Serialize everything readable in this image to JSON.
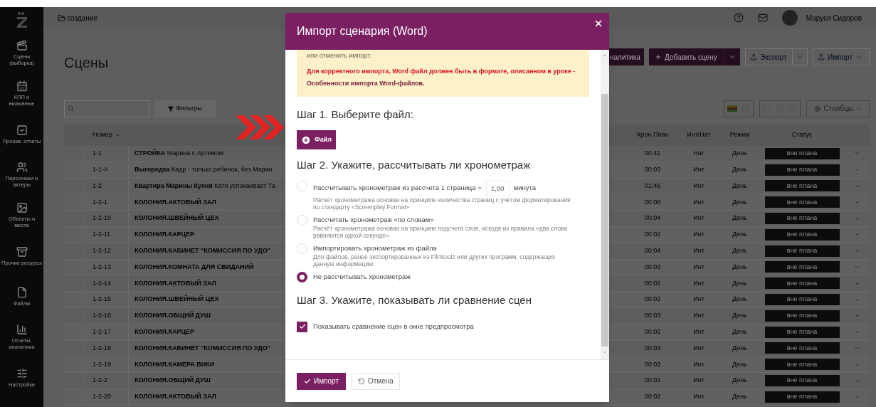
{
  "sidebar": {
    "items": [
      {
        "label": "Сцены (выборка)"
      },
      {
        "label": "КПП и вызывные"
      },
      {
        "label": "Произв. отчеты"
      },
      {
        "label": "Персонажи и актеры"
      },
      {
        "label": "Объекты и места"
      },
      {
        "label": "Прочие ресурсы"
      },
      {
        "label": "Файлы"
      },
      {
        "label": "Отчеты, аналитика"
      },
      {
        "label": "Настройки"
      }
    ]
  },
  "topbar": {
    "breadcrumb": "создание",
    "user_name": "Маруся Сидоров"
  },
  "page": {
    "title": "Сцены",
    "actions": [
      {
        "label": "налитика",
        "kind": "primary"
      },
      {
        "label": "Добавить сцену",
        "kind": "primary-split"
      },
      {
        "label": "Экспорт",
        "kind": "split"
      },
      {
        "label": "Импорт",
        "kind": "dropdown"
      }
    ]
  },
  "toolbar": {
    "filter_button": "Фильтры",
    "columns_button": "Столбцы"
  },
  "table": {
    "columns": [
      "Номер",
      "Хрон.План",
      "Инт/Нат",
      "Режим",
      "Статус"
    ],
    "rows": [
      {
        "number": "1-1",
        "title": "СТРОЙКА",
        "summary": "Марина с Артемом",
        "duration": "00:41",
        "int_ext": "Нат",
        "mode": "День",
        "status": "вне плана"
      },
      {
        "number": "1-1-А",
        "title": "Выгородка",
        "summary": "Кадр - только ребенок, без Марин",
        "duration": "00:03",
        "int_ext": "Инт",
        "mode": "День",
        "status": "вне плана"
      },
      {
        "number": "1-2",
        "title": "Квартира Марины Кухня",
        "summary": "Катя успокаивает Та",
        "duration": "01:46",
        "int_ext": "Инт",
        "mode": "День",
        "status": "вне плана"
      },
      {
        "number": "1-2-1",
        "title": "КОЛОНИЯ.АКТОВЫЙ ЗАЛ",
        "duration": "00:08",
        "int_ext": "Инт",
        "mode": "День",
        "status": "вне плана"
      },
      {
        "number": "1-2-10",
        "title": "КОЛОНИЯ.ШВЕЙНЫЙ ЦЕХ",
        "duration": "00:04",
        "int_ext": "Инт",
        "mode": "День",
        "status": "вне плана"
      },
      {
        "number": "1-2-11",
        "title": "КОЛОНИЯ.КАРЦЕР",
        "duration": "00:02",
        "int_ext": "Инт",
        "mode": "День",
        "status": "вне плана"
      },
      {
        "number": "1-2-12",
        "title": "КОЛОНИЯ.КАБИНЕТ \"КОМИССИЯ ПО УДО\"",
        "duration": "00:04",
        "int_ext": "Инт",
        "mode": "День",
        "status": "вне плана"
      },
      {
        "number": "1-2-13",
        "title": "КОЛОНИЯ.КОМНАТА ДЛЯ СВИДАНИЙ",
        "duration": "00:03",
        "int_ext": "Инт",
        "mode": "День",
        "status": "вне плана"
      },
      {
        "number": "1-2-14",
        "title": "КОЛОНИЯ.АКТОВЫЙ ЗАЛ",
        "duration": "00:02",
        "int_ext": "Инт",
        "mode": "День",
        "status": "вне плана"
      },
      {
        "number": "1-2-15",
        "title": "КОЛОНИЯ.ШВЕЙНЫЙ ЦЕХ",
        "duration": "00:02",
        "int_ext": "Инт",
        "mode": "День",
        "status": "вне плана"
      },
      {
        "number": "1-2-16",
        "title": "КОЛОНИЯ.ОБЩИЙ ДУШ",
        "duration": "00:03",
        "int_ext": "Инт",
        "mode": "День",
        "status": "вне плана"
      },
      {
        "number": "1-2-17",
        "title": "КОЛОНИЯ.КАРЦЕР",
        "duration": "00:02",
        "int_ext": "Инт",
        "mode": "День",
        "status": "вне плана"
      },
      {
        "number": "1-2-18",
        "title": "КОЛОНИЯ.КАБИНЕТ \"КОМИССИЯ ПО УДО\"",
        "duration": "00:03",
        "int_ext": "Инт",
        "mode": "День",
        "status": "вне плана"
      },
      {
        "number": "1-2-19",
        "title": "КОЛОНИЯ.КАМЕРА ВИКИ",
        "duration": "00:03",
        "int_ext": "Инт",
        "mode": "День",
        "status": "вне плана"
      },
      {
        "number": "1-2-2",
        "title": "КОЛОНИЯ.ОБЩИЙ ДУШ",
        "duration": "00:02",
        "int_ext": "Инт",
        "mode": "День",
        "status": "вне плана"
      },
      {
        "number": "1-2-20",
        "title": "КОЛОНИЯ.АКТОВЫЙ ЗАЛ",
        "duration": "00:02",
        "int_ext": "Инт",
        "mode": "День",
        "status": "вне плана"
      }
    ]
  },
  "modal": {
    "title": "Импорт сценария (Word)",
    "notice": {
      "text": "или отменить импорт.",
      "warning": "Для корректного импорта, Word файл должен быть в формате, описанном в уроке -",
      "link": "Особенности импорта Word-файлов."
    },
    "step1": {
      "heading": "Шаг 1. Выберите файл:",
      "button": "Файл"
    },
    "step2": {
      "heading": "Шаг 2. Укажите, рассчитывать ли хронометраж",
      "options": [
        {
          "label": "Рассчитывать хронометраж из рассчета 1 страница =",
          "value": "1,00",
          "unit": "минута",
          "description": "Расчёт хронометража основан на принципе количества страниц с учётом форматирования по стандарту «Screenplay Format»",
          "selected": false
        },
        {
          "label": "Рассчитать хронометраж «по словам»",
          "description": "Расчёт хронометража основан на принципе подсчета слов, исходя из правила «два слова равняются одной секунде».",
          "selected": false
        },
        {
          "label": "Импортировать хронометраж из файла",
          "description": "Для файлов, ранее экспортированных из Filmtoolz или других программ, содержащих данную информацию",
          "selected": false
        },
        {
          "label": "Не рассчитывать хронометраж",
          "selected": true
        }
      ]
    },
    "step3": {
      "heading": "Шаг 3. Укажите, показывать ли сравнение сцен",
      "checkbox": {
        "label": "Показывать сравнение сцен в окне предпросмотра",
        "checked": true
      }
    },
    "footer": {
      "import_button": "Импорт",
      "cancel_button": "Отмена"
    }
  }
}
